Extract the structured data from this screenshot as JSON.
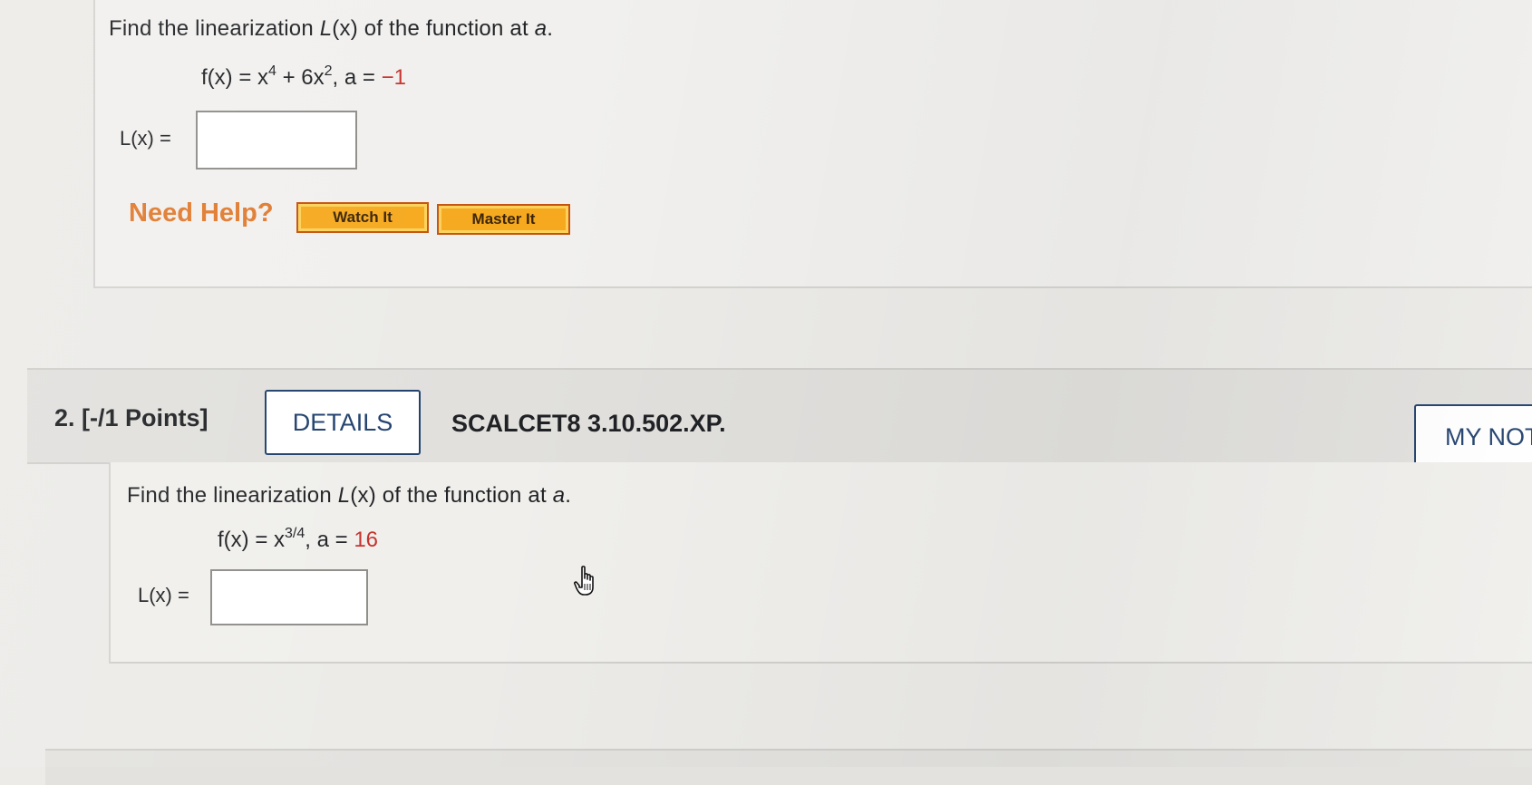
{
  "question1": {
    "prompt_prefix": "Find the linearization ",
    "prompt_italic": "L",
    "prompt_mid": "(x)",
    "prompt_suffix": " of the function at ",
    "prompt_var": "a",
    "prompt_end": ".",
    "formula_lhs": "f(x) = x",
    "formula_exp1": "4",
    "formula_mid": " + 6x",
    "formula_exp2": "2",
    "formula_sep": ", a = ",
    "formula_a_value": "−1",
    "answer_label": "L(x) =",
    "answer_value": "",
    "need_help": "Need Help?",
    "watch_it": "Watch It",
    "master_it": "Master It"
  },
  "question2": {
    "number_points": "2.  [-/1 Points]",
    "details_button": "DETAILS",
    "code": "SCALCET8 3.10.502.XP.",
    "my_notes_button": "MY NOTES",
    "prompt_prefix": "Find the linearization ",
    "prompt_italic": "L",
    "prompt_mid": "(x)",
    "prompt_suffix": " of the function at ",
    "prompt_var": "a",
    "prompt_end": ".",
    "formula_lhs": "f(x) = x",
    "formula_exp": "3/4",
    "formula_sep": ", a = ",
    "formula_a_value": "16",
    "answer_label": "L(x) =",
    "answer_value": ""
  },
  "colors": {
    "accent_red": "#c4302b",
    "help_orange": "#e07a2e",
    "button_orange": "#f6a91e",
    "details_border": "#1f3f6b"
  }
}
